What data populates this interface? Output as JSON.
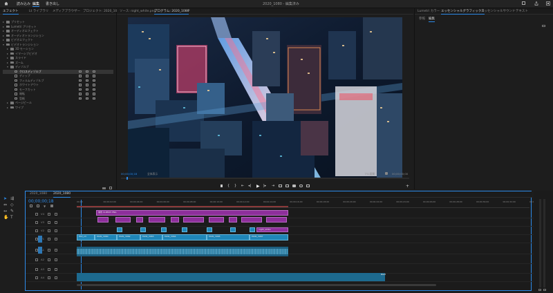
{
  "topbar": {
    "nav": [
      "読み込み",
      "編集",
      "書き出し"
    ],
    "active_nav": "編集",
    "title": "2020_1080 - 編集済み"
  },
  "left_panel": {
    "tabs": [
      "エフェクト",
      "Lt ライブラリ",
      "メディアブラウザー",
      "プロジェクト: 2020_1080"
    ],
    "items": [
      {
        "label": "プリセット",
        "level": 0
      },
      {
        "label": "Lumetri プリセット",
        "level": 0
      },
      {
        "label": "オーディオエフェクト",
        "level": 0
      },
      {
        "label": "オーディオトランジション",
        "level": 0
      },
      {
        "label": "ビデオエフェクト",
        "level": 0
      },
      {
        "label": "ビデオトランジション",
        "level": 0,
        "open": true
      },
      {
        "label": "3D モーション",
        "level": 1
      },
      {
        "label": "イマーシブビデオ",
        "level": 1
      },
      {
        "label": "スライド",
        "level": 1
      },
      {
        "label": "ズーム",
        "level": 1
      },
      {
        "label": "ディゾルブ",
        "level": 1,
        "open": true
      },
      {
        "label": "クロスディゾルブ",
        "level": 2,
        "selected": true
      },
      {
        "label": "ディップ",
        "level": 2
      },
      {
        "label": "フィルムディゾルブ",
        "level": 2
      },
      {
        "label": "ホワイトアウト",
        "level": 2
      },
      {
        "label": "モーフカット",
        "level": 2
      },
      {
        "label": "暗転",
        "level": 2
      },
      {
        "label": "型紙",
        "level": 2
      },
      {
        "label": "ページピール",
        "level": 1
      },
      {
        "label": "ワイプ",
        "level": 1
      }
    ]
  },
  "source_panel": {
    "tabs": [
      "ソース: night_white.png",
      "プログラム: 2020_1080",
      "≡"
    ]
  },
  "program_monitor": {
    "timecode_in": "00;00;00;18",
    "fit": "全体表示",
    "quality": "フル画質",
    "timecode_out": "00;00;00;00"
  },
  "right_panel": {
    "tabs": [
      "Lumetri カラー",
      "エッセンシャルグラフィックス",
      "エッセンシャルサウンド",
      "テキスト"
    ],
    "subtabs": [
      "参照",
      "編集"
    ]
  },
  "timeline": {
    "tabs": [
      "2020_1080",
      "2020_1080"
    ],
    "timecode": "00;00;00;18",
    "ruler_labels": [
      "00;00",
      "00;00;02;00",
      "00;00;04;00",
      "00;00;06;00",
      "00;00;08;00",
      "00;00;10;00",
      "00;00;12;00",
      "00;00;14;00",
      "00;00;16;00",
      "00;00;18;00",
      "00;00;20;00",
      "00;00;22;00",
      "00;00;24;00",
      "00;00;26;00",
      "00;00;28;00",
      "00;00;30;00",
      "00;00;32;00",
      "00;00;34;00"
    ],
    "tracks": [
      "V4",
      "V3",
      "V2",
      "V1",
      "A1",
      "A2",
      "A3",
      "A4"
    ],
    "clip_labels": {
      "v4_title": "城市 CLIP005 PNG",
      "v2_last": "night_white",
      "v1": [
        "MVI_13",
        "MVI0_3060",
        "MVI0_3062",
        "MVI0_3063",
        "MVI0_3064",
        "MVI0_3065",
        "MVI0_3067"
      ],
      "audio": "BGM"
    }
  },
  "colors": {
    "accent": "#2d8ceb",
    "video_clip": "#1f86b8",
    "title_clip": "#8d2f9b",
    "audio_clip": "#1d5f80"
  }
}
